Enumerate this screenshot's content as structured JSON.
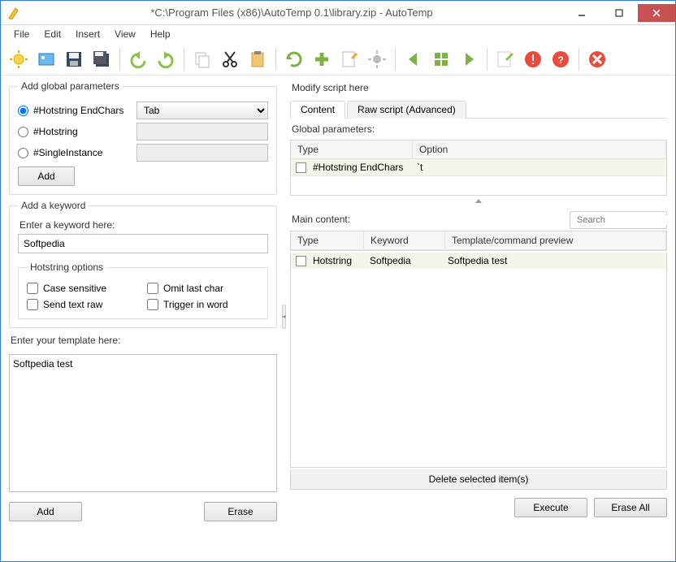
{
  "window": {
    "title": "*C:\\Program Files (x86)\\AutoTemp 0.1\\library.zip - AutoTemp"
  },
  "menu": {
    "items": [
      "File",
      "Edit",
      "Insert",
      "View",
      "Help"
    ]
  },
  "toolbar_icons": [
    "sun-icon",
    "image-icon",
    "save-icon",
    "save-all-icon",
    "sep",
    "undo-icon",
    "redo-icon",
    "sep",
    "copy-icon",
    "cut-icon",
    "paste-icon",
    "sep",
    "refresh-icon",
    "plus-icon",
    "edit-icon",
    "gear-icon",
    "sep",
    "back-icon",
    "grid-icon",
    "forward-icon",
    "sep",
    "compose-icon",
    "alert-icon",
    "help-icon",
    "sep",
    "delete-icon"
  ],
  "left": {
    "global": {
      "legend": "Add global parameters",
      "options": [
        {
          "label": "#Hotstring EndChars",
          "selected": true,
          "value": "Tab"
        },
        {
          "label": "#Hotstring",
          "selected": false,
          "value": ""
        },
        {
          "label": "#SingleInstance",
          "selected": false,
          "value": ""
        }
      ],
      "add": "Add"
    },
    "keyword": {
      "legend": "Add a keyword",
      "prompt": "Enter a keyword here:",
      "value": "Softpedia",
      "hs_legend": "Hotstring options",
      "checks": [
        {
          "label": "Case sensitive"
        },
        {
          "label": "Omit last char"
        },
        {
          "label": "Send text raw"
        },
        {
          "label": "Trigger in word"
        }
      ]
    },
    "template": {
      "prompt": "Enter your template here:",
      "value": "Softpedia test",
      "add": "Add",
      "erase": "Erase"
    }
  },
  "right": {
    "modify_label": "Modify script here",
    "tabs": [
      {
        "label": "Content",
        "active": true
      },
      {
        "label": "Raw script (Advanced)",
        "active": false
      }
    ],
    "global_label": "Global parameters:",
    "global_headers": [
      "Type",
      "Option"
    ],
    "global_rows": [
      {
        "type": "#Hotstring EndChars",
        "option": "`t"
      }
    ],
    "main_label": "Main content:",
    "search_placeholder": "Search",
    "main_headers": [
      "Type",
      "Keyword",
      "Template/command preview"
    ],
    "main_rows": [
      {
        "type": "Hotstring",
        "keyword": "Softpedia",
        "preview": "Softpedia test"
      }
    ],
    "delete_label": "Delete selected item(s)",
    "execute": "Execute",
    "erase_all": "Erase All"
  }
}
